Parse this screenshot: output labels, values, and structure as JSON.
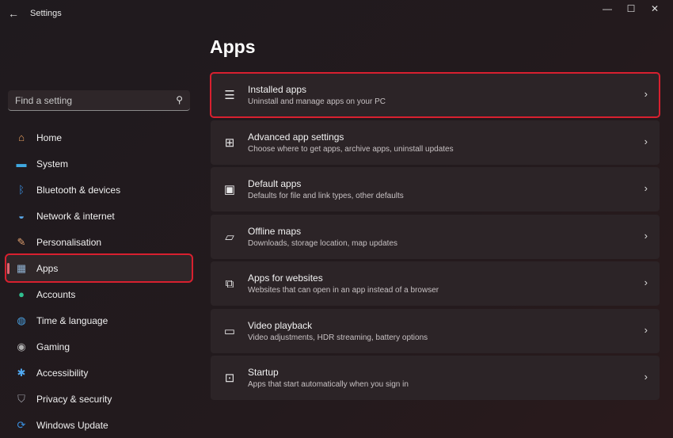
{
  "window": {
    "title": "Settings",
    "minimize": "—",
    "maximize": "☐",
    "close": "✕",
    "back": "←"
  },
  "search": {
    "placeholder": "Find a setting"
  },
  "sidebar": {
    "items": [
      {
        "label": "Home",
        "icon": "home-icon",
        "glyph": "⌂",
        "color": "#e8a060"
      },
      {
        "label": "System",
        "icon": "system-icon",
        "glyph": "▬",
        "color": "#3fa8e0"
      },
      {
        "label": "Bluetooth & devices",
        "icon": "bluetooth-icon",
        "glyph": "ᛒ",
        "color": "#3a8fe0"
      },
      {
        "label": "Network & internet",
        "icon": "wifi-icon",
        "glyph": "◒",
        "color": "#5aa8e8"
      },
      {
        "label": "Personalisation",
        "icon": "brush-icon",
        "glyph": "✎",
        "color": "#e0a070"
      },
      {
        "label": "Apps",
        "icon": "apps-icon",
        "glyph": "▦",
        "color": "#8fb0d0"
      },
      {
        "label": "Accounts",
        "icon": "accounts-icon",
        "glyph": "●",
        "color": "#30c090"
      },
      {
        "label": "Time & language",
        "icon": "globe-icon",
        "glyph": "◍",
        "color": "#4aa0e0"
      },
      {
        "label": "Gaming",
        "icon": "gamepad-icon",
        "glyph": "◉",
        "color": "#b0b0b0"
      },
      {
        "label": "Accessibility",
        "icon": "accessibility-icon",
        "glyph": "✱",
        "color": "#50a8f0"
      },
      {
        "label": "Privacy & security",
        "icon": "shield-icon",
        "glyph": "⛉",
        "color": "#a0a0a8"
      },
      {
        "label": "Windows Update",
        "icon": "update-icon",
        "glyph": "⟳",
        "color": "#3a90e0"
      }
    ],
    "active": "Apps"
  },
  "main": {
    "title": "Apps",
    "cards": [
      {
        "title": "Installed apps",
        "subtitle": "Uninstall and manage apps on your PC",
        "icon": "list-icon",
        "glyph": "☰"
      },
      {
        "title": "Advanced app settings",
        "subtitle": "Choose where to get apps, archive apps, uninstall updates",
        "icon": "app-settings-icon",
        "glyph": "⊞"
      },
      {
        "title": "Default apps",
        "subtitle": "Defaults for file and link types, other defaults",
        "icon": "default-apps-icon",
        "glyph": "▣"
      },
      {
        "title": "Offline maps",
        "subtitle": "Downloads, storage location, map updates",
        "icon": "map-icon",
        "glyph": "▱"
      },
      {
        "title": "Apps for websites",
        "subtitle": "Websites that can open in an app instead of a browser",
        "icon": "web-app-icon",
        "glyph": "⧉"
      },
      {
        "title": "Video playback",
        "subtitle": "Video adjustments, HDR streaming, battery options",
        "icon": "video-icon",
        "glyph": "▭"
      },
      {
        "title": "Startup",
        "subtitle": "Apps that start automatically when you sign in",
        "icon": "startup-icon",
        "glyph": "⊡"
      }
    ]
  },
  "colors": {
    "highlight": "#d8202f"
  }
}
